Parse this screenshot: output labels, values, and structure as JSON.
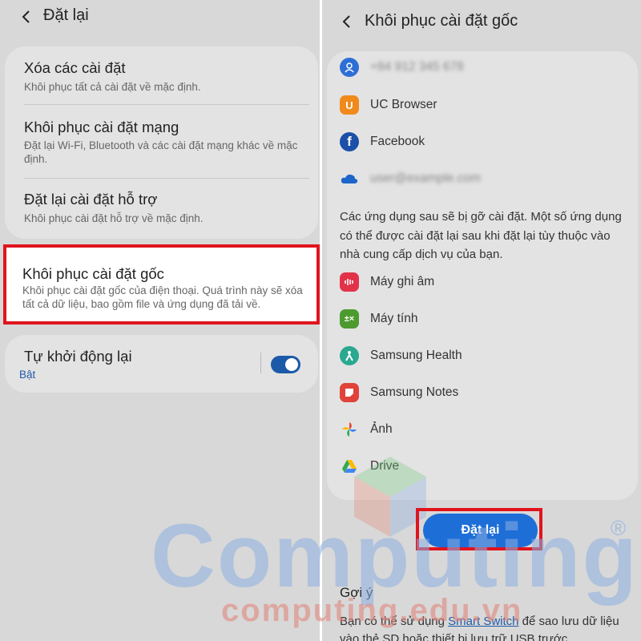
{
  "left": {
    "title": "Đặt lại",
    "items": [
      {
        "title": "Xóa các cài đặt",
        "desc": "Khôi phục tất cả cài đặt về mặc định."
      },
      {
        "title": "Khôi phục cài đặt mạng",
        "desc": "Đặt lại Wi-Fi, Bluetooth và các cài đặt mạng khác về mặc định."
      },
      {
        "title": "Đặt lại cài đặt hỗ trợ",
        "desc": "Khôi phục cài đặt hỗ trợ về mặc định."
      }
    ],
    "factory": {
      "title": "Khôi phục cài đặt gốc",
      "desc": "Khôi phục cài đặt gốc của điện thoại. Quá trình này sẽ xóa tất cả dữ liệu, bao gồm file và ứng dụng đã tải về."
    },
    "restart": {
      "title": "Tự khởi động lại",
      "status": "Bật",
      "enabled": true
    }
  },
  "right": {
    "title": "Khôi phục cài đặt gốc",
    "accounts": [
      {
        "icon": "samsung-account-icon",
        "name": "+84 912 345 678",
        "blurred": true
      },
      {
        "icon": "uc-browser-icon",
        "name": "UC Browser",
        "blurred": false
      },
      {
        "icon": "facebook-icon",
        "name": "Facebook",
        "blurred": false
      },
      {
        "icon": "onedrive-icon",
        "name": "user@example.com",
        "blurred": true
      }
    ],
    "note": "Các ứng dụng sau sẽ bị gỡ cài đặt. Một số ứng dụng có thể được cài đặt lại sau khi đặt lại tùy thuộc vào nhà cung cấp dịch vụ của bạn.",
    "apps": [
      {
        "icon": "voice-recorder-icon",
        "name": "Máy ghi âm"
      },
      {
        "icon": "calculator-icon",
        "name": "Máy tính"
      },
      {
        "icon": "samsung-health-icon",
        "name": "Samsung Health"
      },
      {
        "icon": "samsung-notes-icon",
        "name": "Samsung Notes"
      },
      {
        "icon": "google-photos-icon",
        "name": "Ảnh"
      },
      {
        "icon": "google-drive-icon",
        "name": "Drive"
      }
    ],
    "reset_button": "Đặt lại",
    "suggest_title": "Gợi ý",
    "suggest_pre": "Bạn có thể sử dụng ",
    "suggest_link": "Smart Switch",
    "suggest_post": " để sao lưu dữ liệu vào thẻ SD hoặc thiết bị lưu trữ USB trước"
  },
  "watermark": {
    "brand": "Computing",
    "site": "computing.edu.vn",
    "reg": "®"
  },
  "colors": {
    "accent": "#1e6ed8",
    "highlight": "#e0141e",
    "link": "#1f5aa6"
  }
}
